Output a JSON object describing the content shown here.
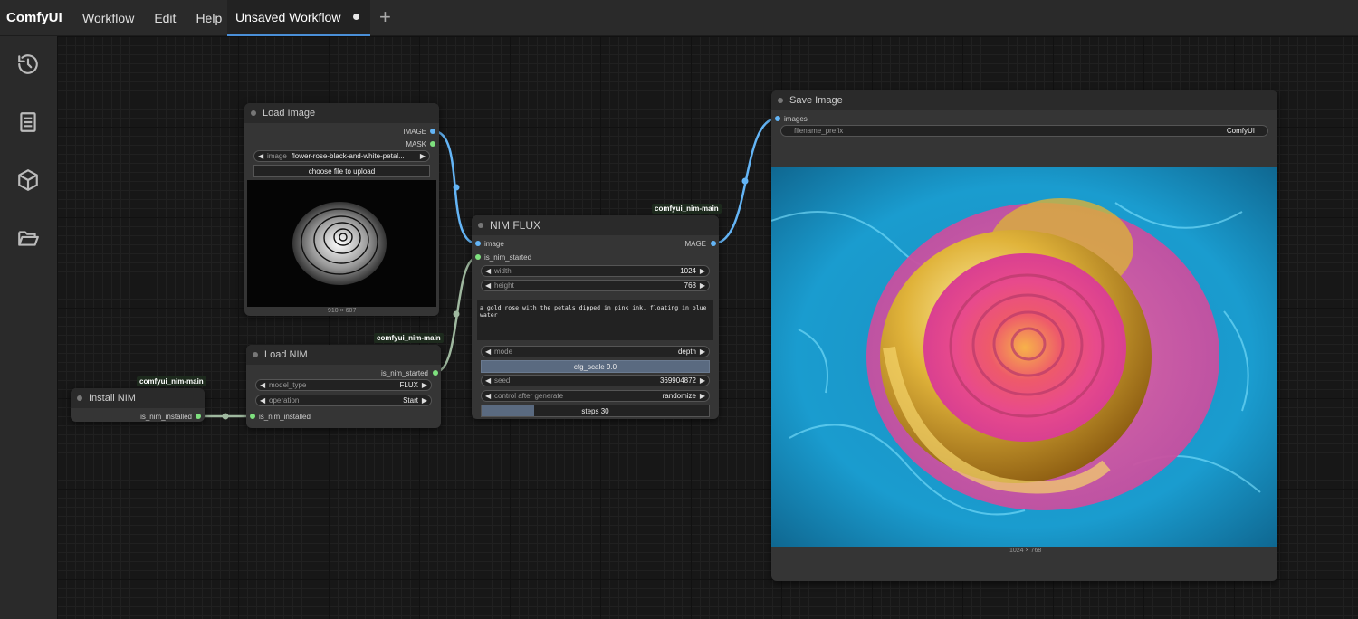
{
  "app": {
    "name": "ComfyUI"
  },
  "menu": [
    "Workflow",
    "Edit",
    "Help"
  ],
  "tab": {
    "label": "Unsaved Workflow",
    "add_icon": "plus-icon"
  },
  "sidebar": [
    "history-icon",
    "book-icon",
    "cube-icon",
    "folder-open-icon"
  ],
  "nodes": {
    "load_image": {
      "title": "Load Image",
      "outputs": [
        "IMAGE",
        "MASK"
      ],
      "image_label": "image",
      "image_value": "flower-rose-black-and-white-petal...",
      "upload": "choose file to upload",
      "dims": "910 × 607"
    },
    "install_nim": {
      "title": "Install NIM",
      "badge": "comfyui_nim-main",
      "output": "is_nim_installed"
    },
    "load_nim": {
      "title": "Load NIM",
      "badge": "comfyui_nim-main",
      "output": "is_nim_started",
      "input": "is_nim_installed",
      "model_type_label": "model_type",
      "model_type_value": "FLUX",
      "operation_label": "operation",
      "operation_value": "Start"
    },
    "nim_flux": {
      "title": "NIM FLUX",
      "badge": "comfyui_nim-main",
      "in_image": "image",
      "in_started": "is_nim_started",
      "out_image": "IMAGE",
      "width_label": "width",
      "width_value": "1024",
      "height_label": "height",
      "height_value": "768",
      "prompt": "a gold rose with the petals dipped in pink ink, floating in blue water",
      "mode_label": "mode",
      "mode_value": "depth",
      "cfg": "cfg_scale  9.0",
      "seed_label": "seed",
      "seed_value": "369904872",
      "control_label": "control after generate",
      "control_value": "randomize",
      "steps": "steps  30",
      "steps_fraction": 0.23
    },
    "save_image": {
      "title": "Save Image",
      "input": "images",
      "prefix_label": "filename_prefix",
      "prefix_value": "ComfyUI",
      "dims": "1024 × 768"
    }
  },
  "colors": {
    "image_wire": "#64b5f6",
    "bool_wire": "#9fb89f",
    "accent": "#4a8fd8"
  }
}
